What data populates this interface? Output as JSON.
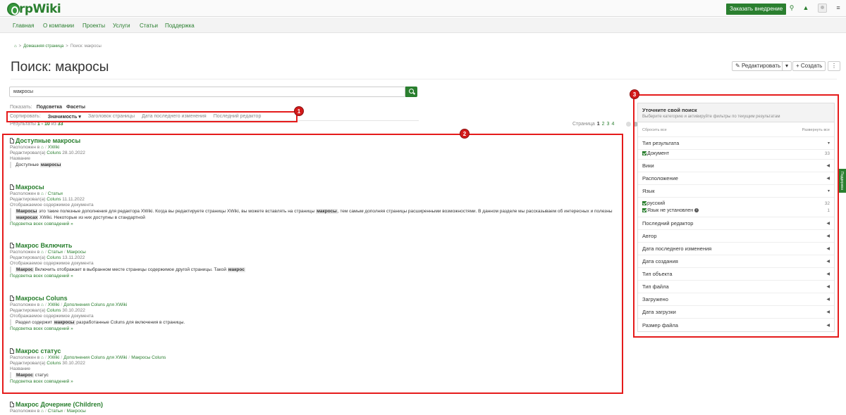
{
  "header": {
    "logo_text": "rpWiki",
    "order_button": "Заказать внедрение"
  },
  "nav": [
    "Главная",
    "О компании",
    "Проекты",
    "Услуги",
    "Статьи",
    "Поддержка"
  ],
  "breadcrumb": {
    "home": "Домашняя страница",
    "current": "Поиск: макросы"
  },
  "page_title": "Поиск: макросы",
  "toolbar": {
    "edit": "Редактировать",
    "create": "Создать"
  },
  "search": {
    "value": "макросы"
  },
  "show": {
    "label": "Показать:",
    "highlight": "Подсветка",
    "facets": "Фасеты"
  },
  "sort": {
    "label": "Сортировать:",
    "relevance": "Значимость",
    "page_title": "Заголовок страницы",
    "last_modified": "Дата последнего изменения",
    "last_editor": "Последний редактор"
  },
  "results_count": {
    "prefix": "Результаты",
    "range": "1 - 10",
    "of": "из",
    "total": "33"
  },
  "pager": {
    "label": "Страница",
    "current": "1",
    "pages": [
      "2",
      "3",
      "4"
    ]
  },
  "annotations": [
    "1",
    "2",
    "3"
  ],
  "results": [
    {
      "title": "Доступные макросы",
      "located_label": "Расположен в",
      "path": [
        "XWiki"
      ],
      "edited_label": "Редактировал(а)",
      "editor": "Coluns",
      "date": "28.10.2022",
      "field": "Название",
      "snippet_pre": "Доступные ",
      "snippet_mark": "макросы",
      "snippet_post": ""
    },
    {
      "title": "Макросы",
      "located_label": "Расположен в",
      "path": [
        "Статьи"
      ],
      "edited_label": "Редактировал(а)",
      "editor": "Coluns",
      "date": "11.11.2022",
      "field": "Отображаемое содержимое документа",
      "snippet_pre": "",
      "snippet_mark": "Макросы",
      "snippet_post": " это такие полезные дополнения для редактора XWiki. Когда вы редактируете страницы XWiki, вы можете вставлять на страницы ",
      "snippet_mark2": "макросы",
      "snippet_post2": ", тем самым дополняя страницы расширенными возможностями. В данном разделе мы рассказываем об интересных и полезны ",
      "snippet_mark3": "макросах",
      "snippet_post3": " XWiki. Некоторые из них доступны в стандартной",
      "more": "Подсветка всех совпадений »"
    },
    {
      "title": "Макрос Включить",
      "located_label": "Расположен в",
      "path": [
        "Статьи",
        "Макросы"
      ],
      "edited_label": "Редактировал(а)",
      "editor": "Coluns",
      "date": "13.11.2022",
      "field": "Отображаемое содержимое документа",
      "snippet_pre": "",
      "snippet_mark": "Макрос",
      "snippet_post": " Включить отображает в выбранном месте страницы содержимое другой страницы. Такой ",
      "snippet_mark2": "макрос",
      "more": "Подсветка всех совпадений »"
    },
    {
      "title": "Макросы Coluns",
      "located_label": "Расположен в",
      "path": [
        "XWiki",
        "Дополнения Coluns для XWiki"
      ],
      "edited_label": "Редактировал(а)",
      "editor": "Coluns",
      "date": "30.10.2022",
      "field": "Отображаемое содержимое документа",
      "snippet_pre": "Раздел содержит ",
      "snippet_mark": "макросы",
      "snippet_post": " разработанные Coluns для включения в страницы.",
      "more": "Подсветка всех совпадений »"
    },
    {
      "title": "Макрос статус",
      "located_label": "Расположен в",
      "path": [
        "XWiki",
        "Дополнения Coluns для XWiki",
        "Макросы Coluns"
      ],
      "edited_label": "Редактировал(а)",
      "editor": "Coluns",
      "date": "30.10.2022",
      "field": "Название",
      "snippet_pre": "",
      "snippet_mark": "Макрос",
      "snippet_post": " статус",
      "more": "Подсветка всех совпадений »"
    },
    {
      "title": "Макрос Дочерние (Children)",
      "located_label": "Расположен в",
      "path": [
        "Статьи",
        "Макросы"
      ]
    }
  ],
  "facets": {
    "title": "Уточните свой поиск",
    "subtitle": "Выберите категорию и активируйте фильтры по текущим результатам",
    "reset": "Сбросить все",
    "expand": "Развернуть все",
    "result_type": "Тип результата",
    "document": "Документ",
    "document_count": "33",
    "wiki": "Вики",
    "location": "Расположение",
    "language": "Язык",
    "lang_ru": "русский",
    "lang_ru_count": "32",
    "lang_none": "Язык не установлен",
    "lang_none_count": "1",
    "last_editor": "Последний редактор",
    "author": "Автор",
    "last_modified": "Дата последнего изменения",
    "created": "Дата создания",
    "object_type": "Тип объекта",
    "file_type": "Тип файла",
    "uploaded": "Загружено",
    "upload_date": "Дата загрузки",
    "file_size": "Размер файла"
  },
  "side_tab": "Поддержка",
  "colors": {
    "brand": "#2a7f2f",
    "annotation": "#e51b1b"
  }
}
